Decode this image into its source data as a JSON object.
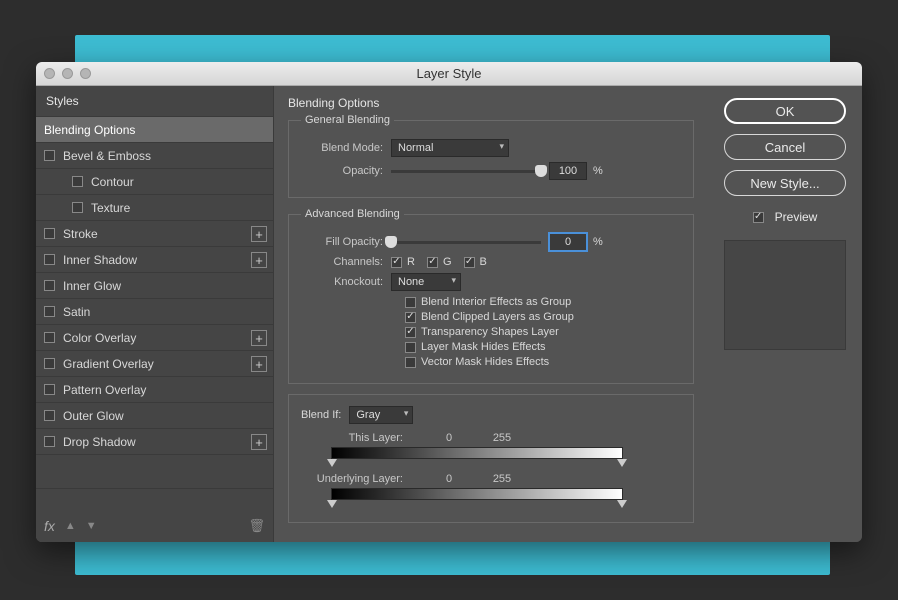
{
  "window": {
    "title": "Layer Style"
  },
  "sidebar": {
    "header": "Styles",
    "items": [
      {
        "label": "Blending Options",
        "checkable": false,
        "selected": true
      },
      {
        "label": "Bevel & Emboss",
        "checkable": true
      },
      {
        "label": "Contour",
        "checkable": true,
        "sub": true
      },
      {
        "label": "Texture",
        "checkable": true,
        "sub": true
      },
      {
        "label": "Stroke",
        "checkable": true,
        "add": true
      },
      {
        "label": "Inner Shadow",
        "checkable": true,
        "add": true
      },
      {
        "label": "Inner Glow",
        "checkable": true
      },
      {
        "label": "Satin",
        "checkable": true
      },
      {
        "label": "Color Overlay",
        "checkable": true,
        "add": true
      },
      {
        "label": "Gradient Overlay",
        "checkable": true,
        "add": true
      },
      {
        "label": "Pattern Overlay",
        "checkable": true
      },
      {
        "label": "Outer Glow",
        "checkable": true
      },
      {
        "label": "Drop Shadow",
        "checkable": true,
        "add": true
      }
    ],
    "fx_label": "fx"
  },
  "main": {
    "title": "Blending Options",
    "general": {
      "legend": "General Blending",
      "blend_mode_label": "Blend Mode:",
      "blend_mode_value": "Normal",
      "opacity_label": "Opacity:",
      "opacity_value": "100",
      "opacity_unit": "%"
    },
    "advanced": {
      "legend": "Advanced Blending",
      "fill_opacity_label": "Fill Opacity:",
      "fill_opacity_value": "0",
      "fill_opacity_unit": "%",
      "channels_label": "Channels:",
      "channel_r": "R",
      "channel_g": "G",
      "channel_b": "B",
      "knockout_label": "Knockout:",
      "knockout_value": "None",
      "opt1": "Blend Interior Effects as Group",
      "opt2": "Blend Clipped Layers as Group",
      "opt3": "Transparency Shapes Layer",
      "opt4": "Layer Mask Hides Effects",
      "opt5": "Vector Mask Hides Effects"
    },
    "blendif": {
      "label": "Blend If:",
      "value": "Gray",
      "this_layer_label": "This Layer:",
      "this_min": "0",
      "this_max": "255",
      "under_label": "Underlying Layer:",
      "under_min": "0",
      "under_max": "255"
    }
  },
  "right": {
    "ok": "OK",
    "cancel": "Cancel",
    "new_style": "New Style...",
    "preview": "Preview"
  }
}
